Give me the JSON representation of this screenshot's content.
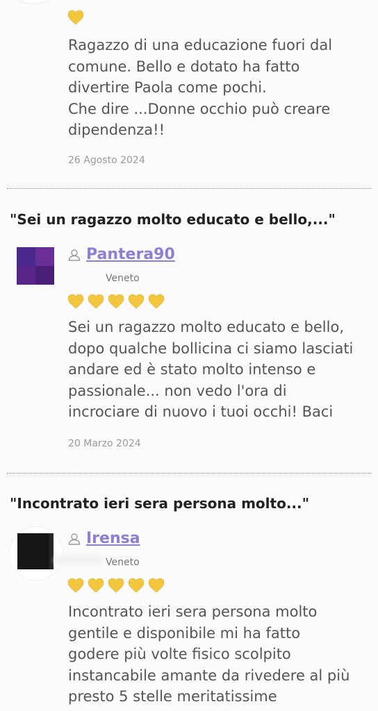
{
  "reviews": [
    {
      "rating": 1,
      "text": "Ragazzo di una educazione fuori dal\ncomune. Bello e dotato ha fatto\ndivertire Paola come pochi.\nChe dire ...Donne occhio può creare\ndipendenza!!",
      "date": "26 Agosto 2024"
    },
    {
      "title": "\"Sei un ragazzo molto educato e bello,...\"",
      "username": "Pantera90",
      "region": "Veneto",
      "rating": 5,
      "text": "Sei un ragazzo molto educato e bello,\ndopo qualche bollicina ci siamo lasciati\nandare ed è stato molto intenso e\npassionale... non vedo l'ora di\nincrociare di nuovo i tuoi occhi! Baci",
      "date": "20 Marzo 2024"
    },
    {
      "title": "\"Incontrato ieri sera persona molto...\"",
      "username": "Irensa",
      "region": "Veneto",
      "rating": 5,
      "text": "Incontrato ieri sera persona molto\ngentile e disponibile mi ha fatto\ngodere più volte fisico scolpito\ninstancabile amante da rivedere al più\npresto 5 stelle meritatissime"
    }
  ],
  "icons": {
    "rating": "yellow-heart-icon",
    "user": "user-silhouette-icon"
  },
  "colors": {
    "heart": "#f3c63f",
    "username": "#8f7fd2",
    "body_text": "#555555",
    "date": "#9a9a9a",
    "title": "#222222"
  }
}
